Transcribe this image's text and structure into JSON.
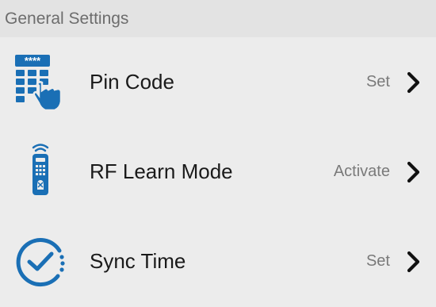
{
  "section": {
    "title": "General Settings"
  },
  "rows": [
    {
      "label": "Pin Code",
      "value": "Set",
      "icon": "keypad-touch-icon"
    },
    {
      "label": "RF Learn Mode",
      "value": "Activate",
      "icon": "rf-remote-icon"
    },
    {
      "label": "Sync Time",
      "value": "Set",
      "icon": "clock-sync-icon"
    }
  ],
  "pin_icon_text": "****",
  "colors": {
    "accent": "#1a6fb5",
    "background": "#ececec",
    "header_background": "#e3e3e3",
    "label": "#1a1a1a",
    "value": "#7a7a7a",
    "header_text": "#6d6d6d"
  }
}
